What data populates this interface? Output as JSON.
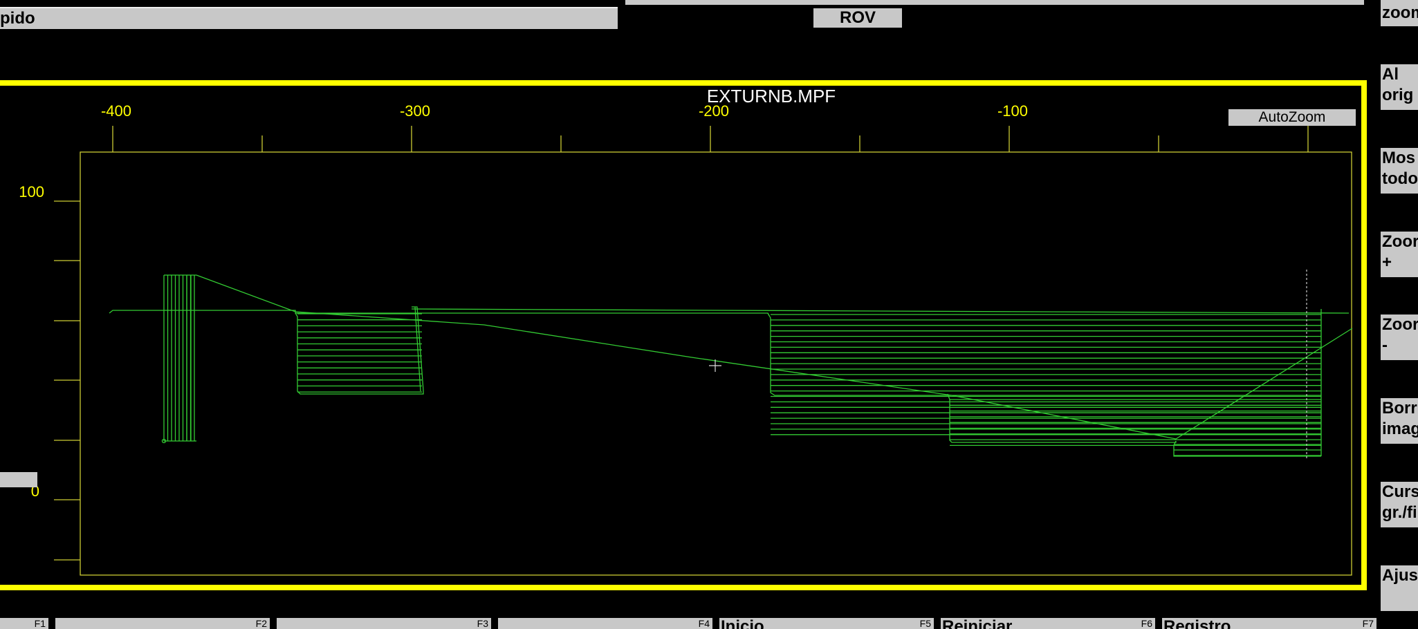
{
  "header": {
    "left_label": "pido",
    "mode_label": "ROV"
  },
  "graphics": {
    "program_name": "EXTURNB.MPF",
    "autozoom_label": "AutoZoom",
    "x_ticks": [
      "-400",
      "-300",
      "-200",
      "-100"
    ],
    "y_ticks": [
      "100",
      "0"
    ],
    "colors": {
      "frame": "#ffff00",
      "axis": "#cccc33",
      "toolpath": "#33cc33",
      "background": "#000000"
    }
  },
  "softkeys_right": [
    {
      "label": "zoom"
    },
    {
      "label": "Al\norig"
    },
    {
      "label": "Mos\ntodo"
    },
    {
      "label": "Zoor\n+"
    },
    {
      "label": "Zoor\n-"
    },
    {
      "label": "Borr\nimag"
    },
    {
      "label": "Curs\ngr./fi"
    },
    {
      "label": "Ajus"
    }
  ],
  "softkeys_bottom": [
    {
      "key": "F1",
      "label": ""
    },
    {
      "key": "F2",
      "label": ""
    },
    {
      "key": "F3",
      "label": ""
    },
    {
      "key": "F4",
      "label": ""
    },
    {
      "key": "F5",
      "label": "Inicio"
    },
    {
      "key": "F6",
      "label": "Reiniciar"
    },
    {
      "key": "F7",
      "label": "Registro"
    }
  ]
}
